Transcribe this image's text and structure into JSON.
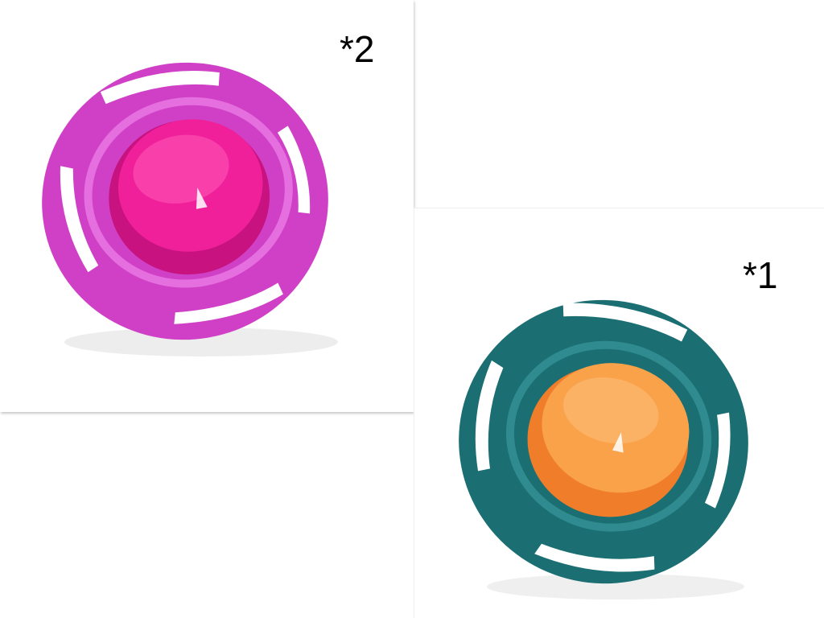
{
  "products": [
    {
      "id": "pink",
      "label": "*2",
      "colors": {
        "frame": "#cf40c6",
        "frame_light": "#e56fdf",
        "bowl": "#f0209a",
        "bowl_dark": "#c81280",
        "bowl_light": "#ff5ab8"
      },
      "icon": "gyro-bowl-icon"
    },
    {
      "id": "teal",
      "label": "*1",
      "colors": {
        "frame": "#1b6f73",
        "frame_light": "#2f8b8f",
        "bowl": "#f9a24a",
        "bowl_dark": "#ef7d2a",
        "bowl_light": "#ffc07a"
      },
      "icon": "gyro-bowl-icon"
    }
  ]
}
